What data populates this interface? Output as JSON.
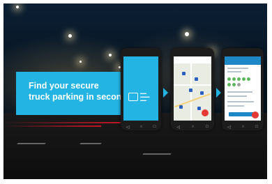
{
  "banner": {
    "line1": "Find your secure",
    "line2": "truck parking in seconds"
  },
  "colors": {
    "accent": "#23b4e3",
    "header_blue": "#1e88c7",
    "fab_red": "#e53935"
  }
}
